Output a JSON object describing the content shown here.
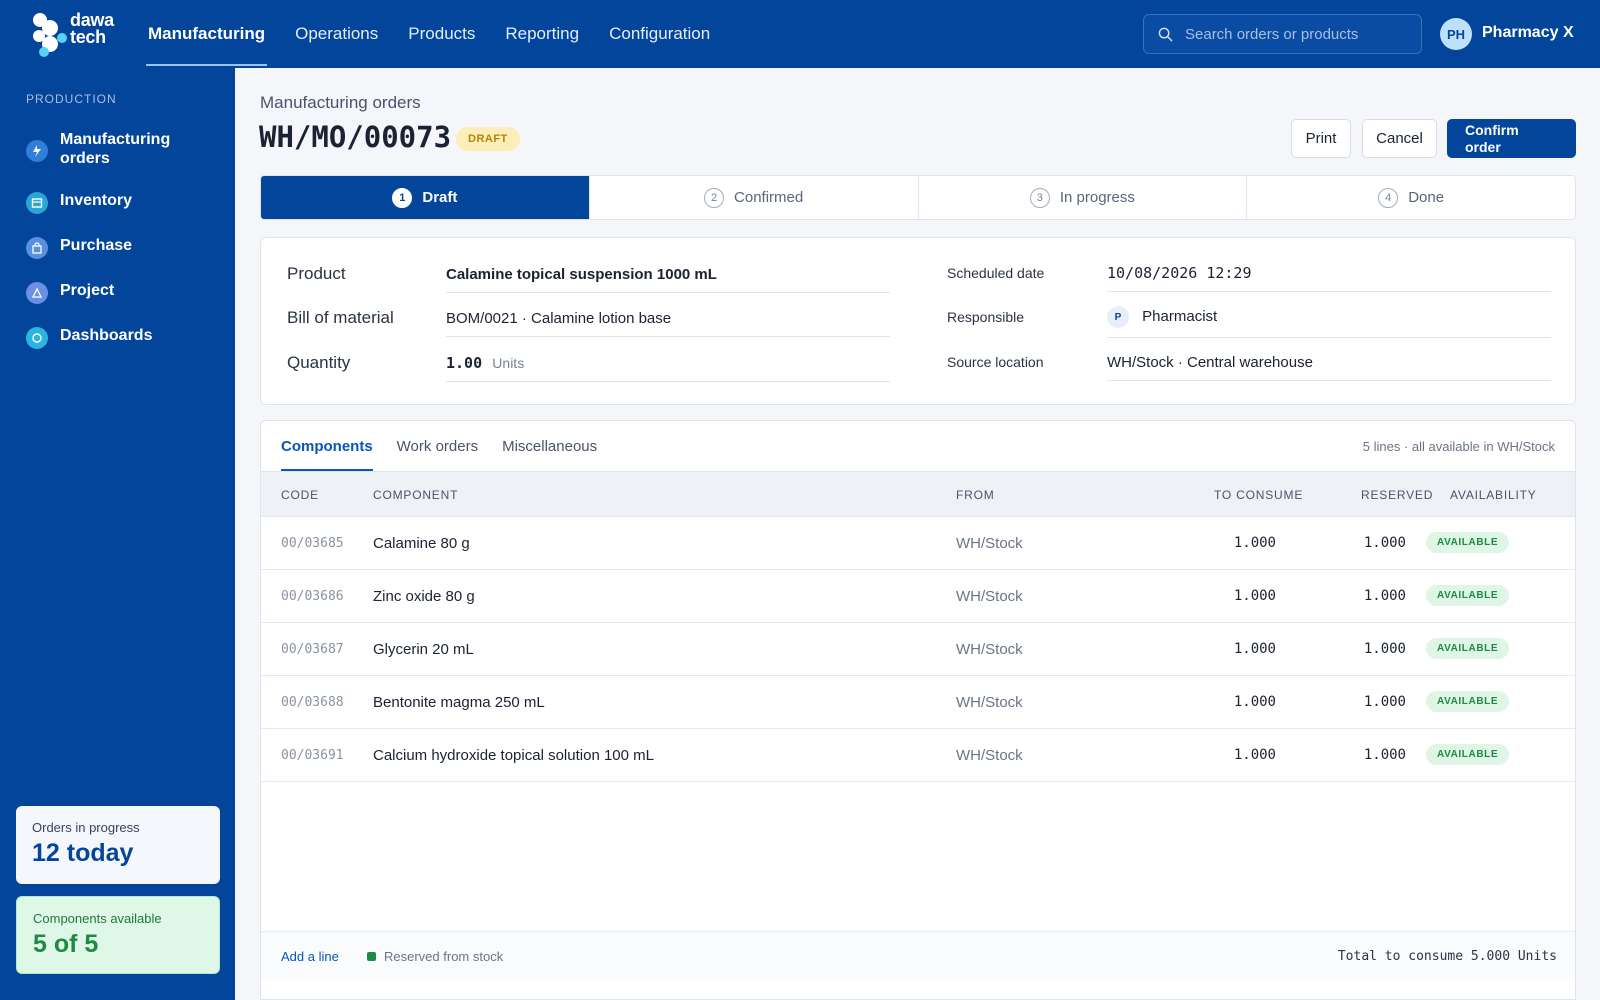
{
  "app": {
    "logo_line1": "dawa",
    "logo_line2": "tech",
    "nav": [
      "Manufacturing",
      "Operations",
      "Products",
      "Reporting",
      "Configuration"
    ],
    "search_placeholder": "Search orders or products",
    "user_initials": "PH",
    "user_name": "Pharmacy X",
    "colors": {
      "brand": "#03459b",
      "draft": "#b88208",
      "available": "#1f8a43"
    }
  },
  "sidebar": {
    "heading": "PRODUCTION",
    "items": [
      {
        "label": "Manufacturing orders",
        "icon": "manufacturing-icon"
      },
      {
        "label": "Inventory",
        "icon": "inventory-icon"
      },
      {
        "label": "Purchase",
        "icon": "purchase-icon"
      },
      {
        "label": "Project",
        "icon": "project-icon"
      },
      {
        "label": "Dashboards",
        "icon": "dashboards-icon"
      }
    ],
    "stat_in_progress": {
      "label": "Orders in progress",
      "value": "12 today"
    },
    "stat_components": {
      "label": "Components available",
      "value": "5 of 5"
    }
  },
  "page": {
    "breadcrumb": "Manufacturing orders",
    "order_number": "WH/MO/00073",
    "status_badge": "DRAFT",
    "actions": {
      "print": "Print",
      "cancel": "Cancel",
      "confirm": "Confirm order"
    }
  },
  "steps": [
    {
      "num": "1",
      "label": "Draft"
    },
    {
      "num": "2",
      "label": "Confirmed"
    },
    {
      "num": "3",
      "label": "In progress"
    },
    {
      "num": "4",
      "label": "Done"
    }
  ],
  "form": {
    "product_label": "Product",
    "product_value": "Calamine topical suspension 1000 mL",
    "bom_label": "Bill of material",
    "bom_value": "BOM/0021 · Calamine lotion base",
    "qty_label": "Quantity",
    "qty_value": "1.00",
    "qty_unit": "Units",
    "date_label": "Scheduled date",
    "date_value": "10/08/2026 12:29",
    "resp_label": "Responsible",
    "resp_initial": "P",
    "resp_value": "Pharmacist",
    "source_label": "Source location",
    "source_value": "WH/Stock · Central warehouse"
  },
  "tabs": [
    "Components",
    "Work orders",
    "Miscellaneous"
  ],
  "tab_summary": "5 lines · all available in WH/Stock",
  "table": {
    "columns": [
      "CODE",
      "COMPONENT",
      "FROM",
      "TO CONSUME",
      "RESERVED",
      "AVAILABILITY"
    ],
    "rows": [
      {
        "code": "00/03685",
        "component": "Calamine 80 g",
        "from": "WH/Stock",
        "to_consume": "1.000",
        "reserved": "1.000",
        "availability": "AVAILABLE"
      },
      {
        "code": "00/03686",
        "component": "Zinc oxide 80 g",
        "from": "WH/Stock",
        "to_consume": "1.000",
        "reserved": "1.000",
        "availability": "AVAILABLE"
      },
      {
        "code": "00/03687",
        "component": "Glycerin 20 mL",
        "from": "WH/Stock",
        "to_consume": "1.000",
        "reserved": "1.000",
        "availability": "AVAILABLE"
      },
      {
        "code": "00/03688",
        "component": "Bentonite magma 250 mL",
        "from": "WH/Stock",
        "to_consume": "1.000",
        "reserved": "1.000",
        "availability": "AVAILABLE"
      },
      {
        "code": "00/03691",
        "component": "Calcium hydroxide topical solution 100 mL",
        "from": "WH/Stock",
        "to_consume": "1.000",
        "reserved": "1.000",
        "availability": "AVAILABLE"
      }
    ]
  },
  "footer": {
    "add_line": "Add a line",
    "legend": "Reserved from stock",
    "total": "Total to consume 5.000 Units"
  }
}
